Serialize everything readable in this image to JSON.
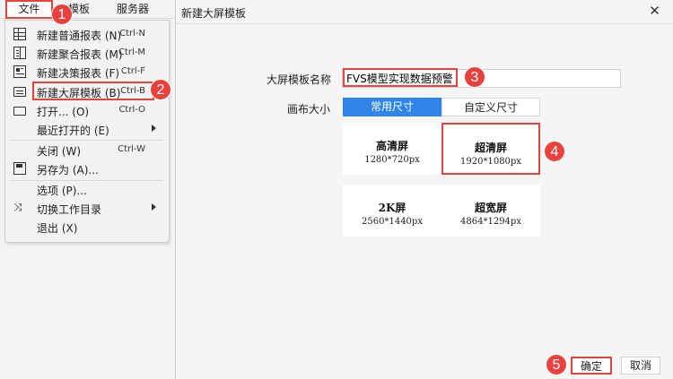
{
  "menubar": {
    "file": "文件",
    "template": "模板",
    "server": "服务器"
  },
  "menu": {
    "items": [
      {
        "label": "新建普通报表 (N)",
        "shortcut": "Ctrl-N",
        "icon": "grid-report-icon"
      },
      {
        "label": "新建聚合报表 (M)",
        "shortcut": "Ctrl-M",
        "icon": "aggregate-report-icon"
      },
      {
        "label": "新建决策报表 (F)",
        "shortcut": "Ctrl-F",
        "icon": "decision-report-icon"
      },
      {
        "label": "新建大屏模板 (B)",
        "shortcut": "Ctrl-B",
        "icon": "screen-template-icon"
      },
      {
        "label": "打开... (O)",
        "shortcut": "Ctrl-O",
        "icon": "folder-icon"
      },
      {
        "label": "最近打开的 (E)",
        "shortcut": "",
        "icon": ""
      },
      {
        "label": "关闭 (W)",
        "shortcut": "Ctrl-W",
        "icon": ""
      },
      {
        "label": "另存为 (A)...",
        "shortcut": "",
        "icon": "save-icon"
      },
      {
        "label": "选项 (P)...",
        "shortcut": "",
        "icon": ""
      },
      {
        "label": "切换工作目录",
        "shortcut": "",
        "icon": "switch-icon"
      },
      {
        "label": "退出 (X)",
        "shortcut": "",
        "icon": ""
      }
    ]
  },
  "dialog": {
    "title": "新建大屏模板",
    "name_label": "大屏模板名称",
    "name_value": "FVS模型实现数据预警",
    "canvas_label": "画布大小",
    "tab_common": "常用尺寸",
    "tab_custom": "自定义尺寸",
    "sizes": [
      {
        "name": "高清屏",
        "res": "1280*720px"
      },
      {
        "name": "超清屏",
        "res": "1920*1080px"
      },
      {
        "name": "2K屏",
        "res": "2560*1440px"
      },
      {
        "name": "超宽屏",
        "res": "4864*1294px"
      }
    ],
    "ok": "确定",
    "cancel": "取消",
    "close_glyph": "✕"
  },
  "badges": [
    "1",
    "2",
    "3",
    "4",
    "5"
  ],
  "colors": {
    "highlight": "#e8413e",
    "accent": "#2f86e8"
  }
}
